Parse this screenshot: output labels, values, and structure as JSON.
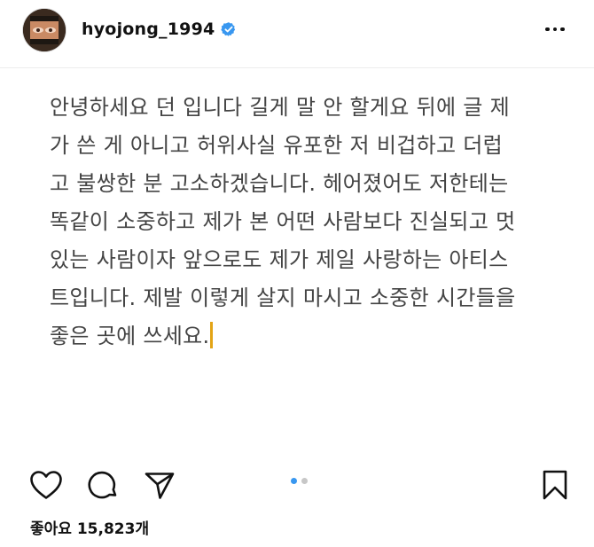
{
  "post": {
    "username": "hyojong_1994",
    "verified": true,
    "body_lines": [
      "안녕하세요 던 입니다 길게 말 안 할게요 뒤에 글 제",
      "가 쓴 게 아니고 허위사실 유포한 저 비겁하고 더럽",
      "고 불쌍한 분 고소하겠습니다. 헤어졌어도 저한테는",
      "똑같이 소중하고 제가 본 어떤 사람보다 진실되고 멋",
      "있는 사람이자 앞으로도 제가 제일 사랑하는 아티스",
      "트입니다. 제발 이렇게 살지 마시고 소중한 시간들을",
      "좋은 곳에 쓰세요."
    ],
    "likes_text": "좋아요 15,823개"
  },
  "carousel": {
    "count": 2,
    "active_index": 0
  },
  "icons": {
    "more": "more-horizontal-icon",
    "like": "heart-icon",
    "comment": "comment-icon",
    "share": "send-icon",
    "save": "bookmark-icon",
    "verified": "verified-badge-icon"
  },
  "colors": {
    "verified_blue": "#3897f0",
    "carousel_active": "#3897f0",
    "carousel_inactive": "#c7c7c7",
    "caret": "#e3a415",
    "text": "#444444"
  }
}
